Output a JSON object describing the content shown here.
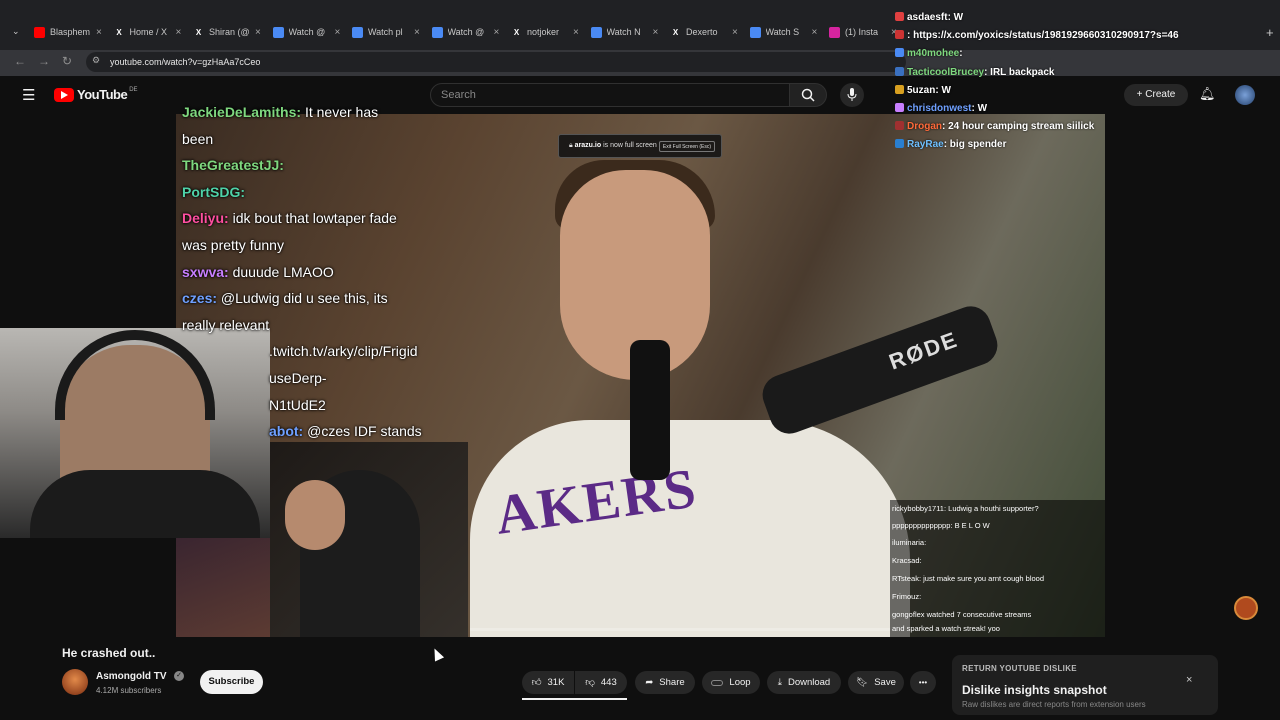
{
  "browser": {
    "tabs": [
      {
        "label": "Blasphem",
        "favicon": "youtube-icon",
        "color": "#ff0000"
      },
      {
        "label": "Home / X",
        "favicon": "x-icon",
        "color": "#000000"
      },
      {
        "label": "Shiran (@",
        "favicon": "x-icon",
        "color": "#000000"
      },
      {
        "label": "Watch @",
        "favicon": "chrome-icon",
        "color": "#4a8af4"
      },
      {
        "label": "Watch pl",
        "favicon": "chrome-icon",
        "color": "#4a8af4"
      },
      {
        "label": "Watch @",
        "favicon": "chrome-icon",
        "color": "#4a8af4"
      },
      {
        "label": "notjoker",
        "favicon": "x-icon",
        "color": "#000000"
      },
      {
        "label": "Watch N",
        "favicon": "chrome-icon",
        "color": "#4a8af4"
      },
      {
        "label": "Dexerto",
        "favicon": "x-icon",
        "color": "#000000"
      },
      {
        "label": "Watch S",
        "favicon": "chrome-icon",
        "color": "#4a8af4"
      },
      {
        "label": "(1) Insta",
        "favicon": "instagram-icon",
        "color": "#d6249f"
      }
    ],
    "url": "youtube.com/watch?v=gzHaAa7cCeo",
    "new_tab_symbol": "+"
  },
  "header": {
    "logo": "YouTube",
    "logo_region": "DE",
    "search_placeholder": "Search",
    "create_label": "Create"
  },
  "video": {
    "fullscreen_toast_site": "arazu.io",
    "fullscreen_toast_text": "is now full screen",
    "fullscreen_exit_label": "Exit Full Screen (Esc)",
    "shirt_text": "AKERS",
    "mic_brand": "RØDE"
  },
  "chat_left": [
    {
      "name": "JackieDeLamiths:",
      "text": "It never has",
      "color": "#7fd87f"
    },
    {
      "name": "",
      "text": "been",
      "color": "#ffffff"
    },
    {
      "name": "TheGreatestJJ:",
      "text": "",
      "color": "#7fd87f"
    },
    {
      "name": "PortSDG:",
      "text": "",
      "color": "#4fd2a8"
    },
    {
      "name": "Deliyu:",
      "text": "idk bout that lowtaper fade",
      "color": "#ff4fa0"
    },
    {
      "name": "",
      "text": "was pretty funny",
      "color": "#ffffff"
    },
    {
      "name": "sxwva:",
      "text": "duuude LMAOO",
      "color": "#c87fff"
    },
    {
      "name": "czes:",
      "text": "@Ludwig did u see this, its",
      "color": "#6fa0ff"
    },
    {
      "name": "",
      "text": "really relevant",
      "color": "#ffffff"
    },
    {
      "name": "",
      "text": ".twitch.tv/arky/clip/Frigid",
      "color": "#ffffff"
    },
    {
      "name": "",
      "text": "useDerp-",
      "color": "#ffffff"
    },
    {
      "name": "",
      "text": "N1tUdE2",
      "color": "#ffffff"
    },
    {
      "name": "abot:",
      "text": "@czes IDF stands",
      "color": "#6fa0ff"
    }
  ],
  "chat_top": [
    {
      "name": "asdaesft",
      "text": ": W",
      "color": "#ffffff"
    },
    {
      "name": "",
      "text": ": https://x.com/yoxics/status/1981929660310290917?s=46",
      "color": "#ffffff"
    },
    {
      "name": "m40mohee",
      "text": ":",
      "color": "#7fd87f"
    },
    {
      "name": "TacticoolBrucey",
      "text": ": IRL backpack",
      "color": "#7fd87f"
    },
    {
      "name": "5uzan",
      "text": ": W",
      "color": "#ffffff"
    },
    {
      "name": "chrisdonwest",
      "text": ": W",
      "color": "#6fa0ff"
    },
    {
      "name": "Drogan",
      "text": ": 24 hour camping stream siilick",
      "color": "#ff6a3a"
    },
    {
      "name": "RayRae",
      "text": ": big spender",
      "color": "#6fc0ff"
    }
  ],
  "chat_bottom": [
    {
      "text": "rickybobby1711: Ludwig a houthi supporter?"
    },
    {
      "text": "pppppppppppppp: B E L O W"
    },
    {
      "text": "iluminaria:"
    },
    {
      "text": "Kracsad:"
    },
    {
      "text": "RTsteak: just make sure you arnt cough blood"
    },
    {
      "text": "Frimouz:"
    },
    {
      "text": "gongoflex watched 7 consecutive streams"
    },
    {
      "text": "and sparked a watch streak! yoo"
    }
  ],
  "meta": {
    "title": "He crashed out..",
    "channel": "Asmongold TV",
    "subscribers": "4.12M subscribers",
    "subscribe_label": "Subscribe",
    "likes": "31K",
    "dislikes": "443",
    "share_label": "Share",
    "loop_label": "Loop",
    "download_label": "Download",
    "save_label": "Save",
    "more_symbol": "•••"
  },
  "ryd": {
    "heading": "RETURN YOUTUBE DISLIKE",
    "title": "Dislike insights snapshot",
    "subtitle": "Raw dislikes are direct reports from extension users",
    "close": "×"
  }
}
